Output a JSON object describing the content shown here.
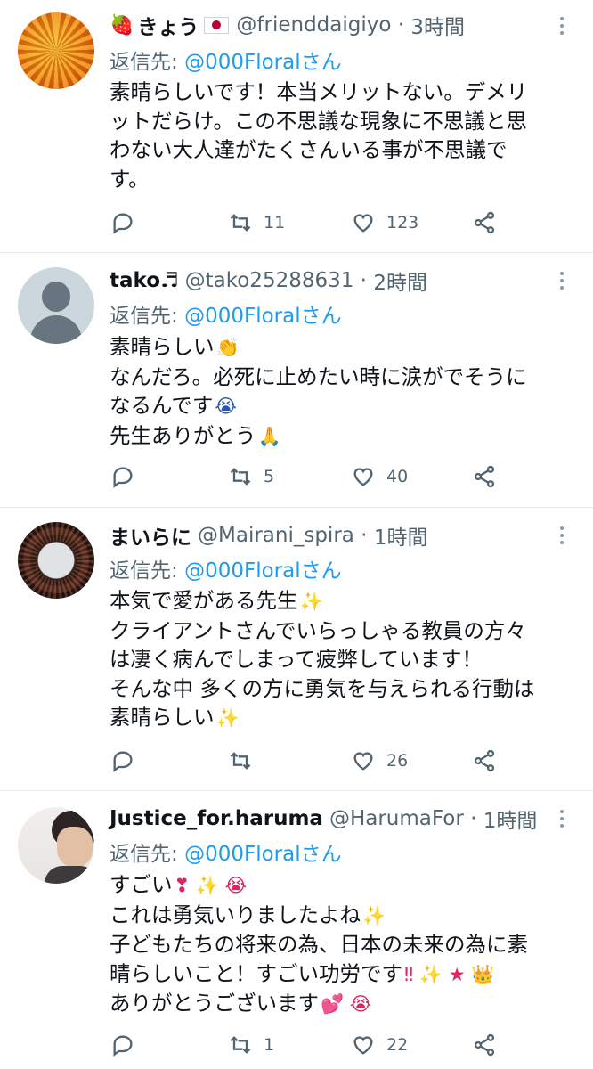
{
  "tweets": [
    {
      "display_name": "きょう",
      "name_emoji": "🍓",
      "name_flag": "Japan flag",
      "handle": "@frienddaigiyo",
      "time": "3時間",
      "reply_label": "返信先: ",
      "reply_to": "@000Floralさん",
      "lines": [
        "素晴らしいです！本当メリットない。デメリ",
        "ットだらけ。この不思議な現象に不思議と思",
        "わない大人達がたくさんいる事が不思議で",
        "す。"
      ],
      "retweets": "11",
      "likes": "123"
    },
    {
      "display_name": "tako",
      "name_emoji": "♬",
      "handle": "@tako25288631",
      "time": "2時間",
      "reply_label": "返信先: ",
      "reply_to": "@000Floralさん",
      "lines": [
        "素晴らしい",
        "なんだろ。必死に止めたい時に涙がでそうに",
        "なるんです",
        "先生ありがとう"
      ],
      "line_emojis": [
        "👏",
        "",
        "😭",
        "🙏"
      ],
      "retweets": "5",
      "likes": "40"
    },
    {
      "display_name": "まいらに",
      "handle": "@Mairani_spira",
      "time": "1時間",
      "reply_label": "返信先: ",
      "reply_to": "@000Floralさん",
      "lines": [
        "本気で愛がある先生",
        "クライアントさんでいらっしゃる教員の方々",
        "は凄く病んでしまって疲弊しています！",
        "そんな中 多くの方に勇気を与えられる行動は",
        "素晴らしい"
      ],
      "line_emojis": [
        "✨",
        "",
        "",
        "",
        "✨"
      ],
      "retweets": "",
      "likes": "26"
    },
    {
      "display_name": "Justice_for.haruma",
      "handle": "@HarumaFor",
      "time": "1時間",
      "reply_label": "返信先: ",
      "reply_to": "@000Floralさん",
      "lines": [
        "すごい",
        "これは勇気いりましたよね",
        "子どもたちの将来の為、日本の未来の為に素",
        "晴らしいこと！すごい功労です",
        "ありがとうございます"
      ],
      "line_emojis": [
        "❣ ✨ 😭",
        "✨",
        "",
        "‼ ✨ ★ 👑",
        "💕 😭"
      ],
      "retweets": "1",
      "likes": "22"
    }
  ],
  "icons": {
    "reply": "reply-icon",
    "retweet": "retweet-icon",
    "like": "heart-icon",
    "share": "share-icon",
    "more": "more-icon"
  },
  "colors": {
    "link": "#1d9bf0",
    "secondary_text": "#536471",
    "divider": "#e6ecf0"
  }
}
